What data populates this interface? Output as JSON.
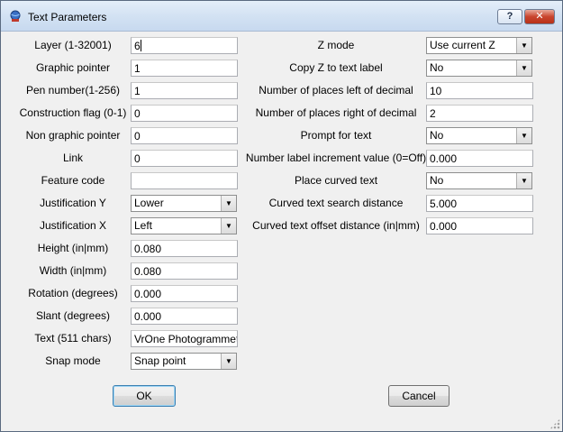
{
  "window": {
    "title": "Text Parameters",
    "help_label": "?",
    "close_label": "✕"
  },
  "left_fields": [
    {
      "label": "Layer (1-32001)",
      "value": "6",
      "kind": "text",
      "focused": true
    },
    {
      "label": "Graphic pointer",
      "value": "1",
      "kind": "text"
    },
    {
      "label": "Pen number(1-256)",
      "value": "1",
      "kind": "text"
    },
    {
      "label": "Construction flag (0-1)",
      "value": "0",
      "kind": "text"
    },
    {
      "label": "Non graphic pointer",
      "value": "0",
      "kind": "text"
    },
    {
      "label": "Link",
      "value": "0",
      "kind": "text"
    },
    {
      "label": "Feature code",
      "value": "",
      "kind": "text"
    },
    {
      "label": "Justification Y",
      "value": "Lower",
      "kind": "combo"
    },
    {
      "label": "Justification X",
      "value": "Left",
      "kind": "combo"
    },
    {
      "label": "Height (in|mm)",
      "value": "0.080",
      "kind": "text"
    },
    {
      "label": "Width (in|mm)",
      "value": "0.080",
      "kind": "text"
    },
    {
      "label": "Rotation (degrees)",
      "value": "0.000",
      "kind": "text"
    },
    {
      "label": "Slant (degrees)",
      "value": "0.000",
      "kind": "text"
    },
    {
      "label": "Text (511 chars)",
      "value": "VrOne Photogrammetry",
      "kind": "text"
    },
    {
      "label": "Snap mode",
      "value": "Snap point",
      "kind": "combo"
    }
  ],
  "right_fields": [
    {
      "label": "Z mode",
      "value": "Use current Z",
      "kind": "combo"
    },
    {
      "label": "Copy Z to text label",
      "value": "No",
      "kind": "combo"
    },
    {
      "label": "Number of places left of decimal",
      "value": "10",
      "kind": "text"
    },
    {
      "label": "Number of places right of decimal",
      "value": "2",
      "kind": "text"
    },
    {
      "label": "Prompt for text",
      "value": "No",
      "kind": "combo"
    },
    {
      "label": "Number label increment value (0=Off)",
      "value": "0.000",
      "kind": "text"
    },
    {
      "label": "Place curved text",
      "value": "No",
      "kind": "combo"
    },
    {
      "label": "Curved text search distance",
      "value": "5.000",
      "kind": "text"
    },
    {
      "label": "Curved text offset distance (in|mm)",
      "value": "0.000",
      "kind": "text"
    }
  ],
  "buttons": {
    "ok": "OK",
    "cancel": "Cancel"
  },
  "icons": {
    "app": "app-globe-icon",
    "dropdown": "chevron-down-icon"
  }
}
